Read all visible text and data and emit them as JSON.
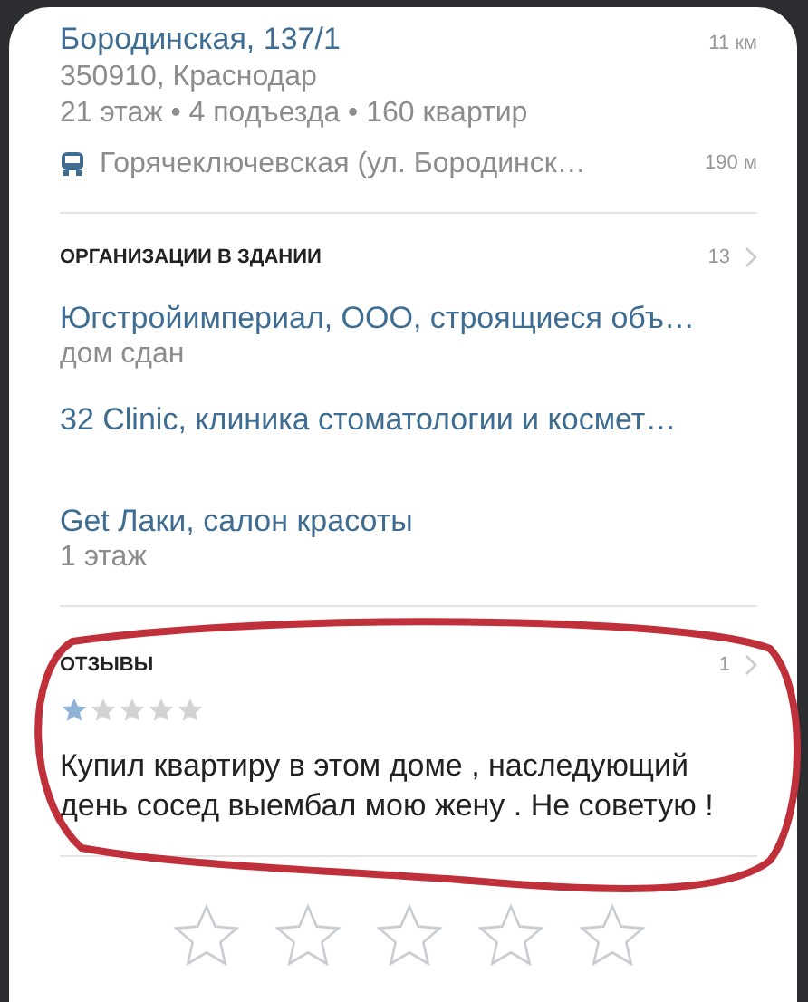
{
  "address": {
    "title": "Бородинская, 137/1",
    "distance": "11 км",
    "postal": "350910, Краснодар",
    "details": "21 этаж • 4 подъезда • 160 квартир",
    "stop": {
      "name": "Горячеключевская (ул. Бородинск…",
      "distance": "190 м"
    }
  },
  "organizations": {
    "heading": "ОРГАНИЗАЦИИ В ЗДАНИИ",
    "count": "13",
    "items": [
      {
        "name": "Югстройимпериал, ООО, строящиеся объ…",
        "note": "дом сдан"
      },
      {
        "name": "32 Clinic, клиника стоматологии и космет…"
      },
      {
        "name": "Get Лаки, салон красоты",
        "note": "1 этаж"
      }
    ]
  },
  "reviews": {
    "heading": "ОТЗЫВЫ",
    "count": "1",
    "items": [
      {
        "stars": 1,
        "text": "Купил квартиру в этом доме , наследующий день сосед выембал мою жену . Не советую !"
      }
    ]
  },
  "rate": {
    "stars": 0
  }
}
